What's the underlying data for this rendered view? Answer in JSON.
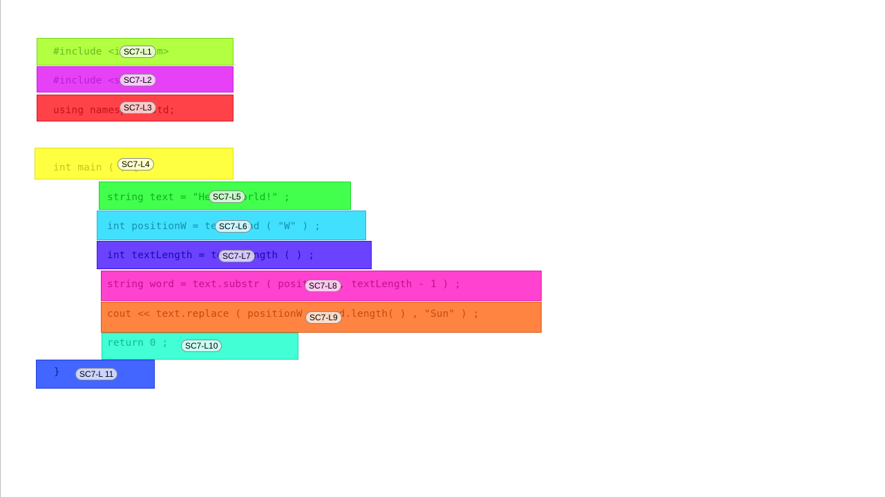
{
  "lines": [
    {
      "code": "#include <iostream>",
      "tag": "SC7-L1",
      "bg": "#b3ff42",
      "border": "#78d420",
      "text_color": "#62bf22"
    },
    {
      "code": "#include <string>",
      "tag": "SC7-L2",
      "bg": "#e641f7",
      "border": "#bf20d6",
      "text_color": "#b81fcf"
    },
    {
      "code": "using namespace std;",
      "tag": "SC7-L3",
      "bg": "#ff4248",
      "border": "#d01c22",
      "text_color": "#c0141a"
    },
    {
      "code": "int main ( ) {",
      "tag": "SC7-L4",
      "bg": "#ffff42",
      "border": "#e0e020",
      "text_color": "#c6c61a"
    },
    {
      "code": "string text = \"Hello World!\" ;",
      "tag": "SC7-L5",
      "bg": "#42ff4e",
      "border": "#20d42a",
      "text_color": "#12ad1c"
    },
    {
      "code": "int positionW = text.find ( \"W\" ) ;",
      "tag": "SC7-L6",
      "bg": "#42e0ff",
      "border": "#1cb8d6",
      "text_color": "#1192ae"
    },
    {
      "code": "int textLength = text.length ( ) ;",
      "tag": "SC7-L7",
      "bg": "#6a42ff",
      "border": "#3c18d8",
      "text_color": "#1e0aa6"
    },
    {
      "code": "string word = text.substr ( positionW , textLength - 1 ) ;",
      "tag": "SC7-L8",
      "bg": "#ff42cf",
      "border": "#d418a8",
      "text_color": "#c0128f"
    },
    {
      "code": "cout << text.replace ( positionW , word.length( ) , \"Sun\" ) ;",
      "tag": "SC7-L9",
      "bg": "#ff8442",
      "border": "#d85a18",
      "text_color": "#c24c10"
    },
    {
      "code": "return 0 ;",
      "tag": "SC7-L10",
      "bg": "#42ffd5",
      "border": "#1cd6ad",
      "text_color": "#12b890"
    },
    {
      "code": "}",
      "tag": "SC7-L 11",
      "bg": "#4266ff",
      "border": "#1a3ed8",
      "text_color": "#0d248e"
    }
  ]
}
